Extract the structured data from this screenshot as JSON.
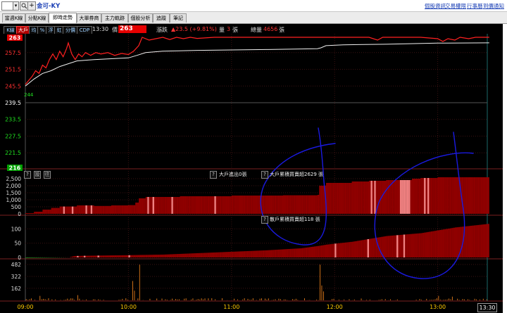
{
  "header": {
    "stock_name": "金可-KY",
    "links": [
      "個股資訊",
      "交易權限",
      "行事曆",
      "到價通知"
    ]
  },
  "tabs": [
    "當週K線",
    "分點K線",
    "即時走勢",
    "大單券商",
    "主力軌跡",
    "個股分析",
    "追蹤",
    "筆記"
  ],
  "active_tab": "即時走勢",
  "toolbar": {
    "buttons": [
      "K線",
      "大戶",
      "均",
      "%",
      "浮",
      "虹",
      "分價",
      "CDP"
    ],
    "time": "13:30",
    "price_label": "價",
    "price": "263",
    "change_label": "漲跌",
    "change": "▲23.5 (+9.81%)",
    "volume_label": "量",
    "volume": "3",
    "volume_unit": "張",
    "total_label": "總量",
    "total": "4656",
    "total_unit": "張"
  },
  "price_axis": {
    "top_badge": "263",
    "ticks": [
      "257.5",
      "251.5",
      "245.5",
      "239.5",
      "233.5",
      "227.5",
      "221.5"
    ],
    "bottom_badge": "216",
    "low_label": "244"
  },
  "panel2": {
    "buttons": [
      "?",
      "設",
      "往"
    ],
    "label_in": "大戶進出0張",
    "label_cum": "大戶累積買賣超2629 張",
    "ticks": [
      "2,500",
      "2,000",
      "1,500",
      "1,000",
      "500",
      "0"
    ]
  },
  "panel3": {
    "label": "散戶累積買賣超118 張",
    "ticks": [
      "100",
      "50",
      "0"
    ]
  },
  "panel4": {
    "ticks": [
      "482",
      "322",
      "162"
    ]
  },
  "x_axis": {
    "ticks": [
      "09:00",
      "10:00",
      "11:00",
      "12:00",
      "13:00"
    ],
    "end_badge": "13:30"
  },
  "colors": {
    "price_line": "#ff2020",
    "avg_line": "#f0f0f0",
    "bar_dark": "#8f0000",
    "bar_light": "#f08080",
    "volume": "#e07a1a",
    "ink": "#1a1ae0"
  }
}
